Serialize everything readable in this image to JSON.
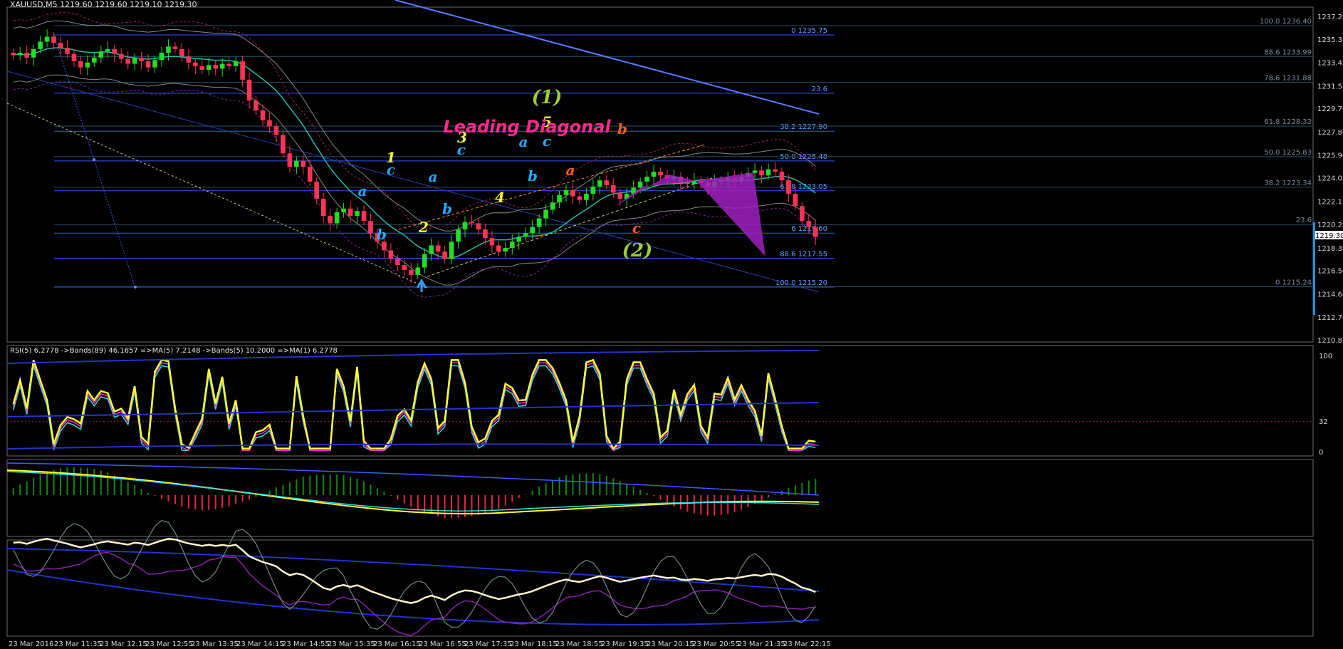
{
  "symbol_header": "XAUUSD,M5  1219.60 1219.60 1219.10 1219.30",
  "rsi_header": "RSI(5) 6.2778  ->Bands(89) 46.1657  =>MA(5) 7.2148  ->Bands(5) 10.2000  =>MA(1) 6.2778",
  "annotation_title": "Leading Diagonal",
  "current_price": "1219.30",
  "colors": {
    "bull": "#22dd22",
    "bear": "#ff3355",
    "fib_line": "#3355ff",
    "trend_line": "#3a5bff",
    "magenta": "#a020c0",
    "rsi": "#ffff33",
    "cyan": "#33dddd",
    "pink": "#ff33cc",
    "accent_title": "#ff2a8a"
  },
  "price_axis": {
    "ticks": [
      "1237.20",
      "1235.35",
      "1233.45",
      "1231.55",
      "1229.70",
      "1227.80",
      "1225.90",
      "1224.05",
      "1222.15",
      "1220.25",
      "1218.35",
      "1216.50",
      "1214.60",
      "1212.70",
      "1210.85"
    ],
    "min": 1210.85,
    "max": 1237.2
  },
  "rsi_axis": {
    "ticks": [
      "100",
      "32",
      "0"
    ]
  },
  "time_axis": {
    "labels": [
      "23 Mar 2016",
      "23 Mar 11:35",
      "23 Mar 12:15",
      "23 Mar 12:55",
      "23 Mar 13:35",
      "23 Mar 14:15",
      "23 Mar 14:55",
      "23 Mar 15:35",
      "23 Mar 16:15",
      "23 Mar 16:55",
      "23 Mar 17:35",
      "23 Mar 18:15",
      "23 Mar 18:55",
      "23 Mar 19:35",
      "23 Mar 20:15",
      "23 Mar 20:55",
      "23 Mar 21:35",
      "23 Mar 22:15"
    ]
  },
  "fib_levels_main": [
    {
      "label": "0 1235.75",
      "price": 1235.75
    },
    {
      "label": "23.6",
      "price": 1231.0
    },
    {
      "label": "38.2 1227.90",
      "price": 1227.9
    },
    {
      "label": "50.0 1225.48",
      "price": 1225.48
    },
    {
      "label": "61.8 1223.05",
      "price": 1223.05
    },
    {
      "label": "6 1219.60",
      "price": 1219.6
    },
    {
      "label": "88.6 1217.55",
      "price": 1217.55
    },
    {
      "label": "100.0 1215.20",
      "price": 1215.2
    }
  ],
  "fib_levels_right": [
    {
      "label": "100.0 1236.40",
      "price": 1236.5
    },
    {
      "label": "88.6 1233.99",
      "price": 1233.99
    },
    {
      "label": "78.6 1231.88",
      "price": 1231.88
    },
    {
      "label": "61.8 1228.32",
      "price": 1228.32
    },
    {
      "label": "50.0 1225.83",
      "price": 1225.83
    },
    {
      "label": "38.2 1223.34",
      "price": 1223.34
    },
    {
      "label": "23.6",
      "price": 1220.3
    },
    {
      "label": "0 1215.24",
      "price": 1215.24
    }
  ],
  "wave_labels": [
    {
      "text": "1",
      "color": "#ffff33",
      "x": 549,
      "y": 228,
      "size": 20
    },
    {
      "text": "2",
      "color": "#ffff33",
      "x": 595,
      "y": 326,
      "size": 20
    },
    {
      "text": "3",
      "color": "#ffff33",
      "x": 649,
      "y": 200,
      "size": 20
    },
    {
      "text": "4",
      "color": "#ffff33",
      "x": 702,
      "y": 284,
      "size": 20
    },
    {
      "text": "5",
      "color": "#ffff33",
      "x": 768,
      "y": 178,
      "size": 20
    },
    {
      "text": "a",
      "color": "#22aaff",
      "x": 509,
      "y": 275,
      "size": 20
    },
    {
      "text": "b",
      "color": "#22aaff",
      "x": 536,
      "y": 336,
      "size": 20
    },
    {
      "text": "c",
      "color": "#22aaff",
      "x": 549,
      "y": 245,
      "size": 20
    },
    {
      "text": "a",
      "color": "#22aaff",
      "x": 608,
      "y": 255,
      "size": 20
    },
    {
      "text": "b",
      "color": "#22aaff",
      "x": 628,
      "y": 300,
      "size": 20
    },
    {
      "text": "c",
      "color": "#22aaff",
      "x": 648,
      "y": 217,
      "size": 20
    },
    {
      "text": "a",
      "color": "#22aaff",
      "x": 735,
      "y": 206,
      "size": 20
    },
    {
      "text": "b",
      "color": "#22aaff",
      "x": 748,
      "y": 254,
      "size": 20
    },
    {
      "text": "c",
      "color": "#22aaff",
      "x": 768,
      "y": 205,
      "size": 20
    },
    {
      "text": "a",
      "color": "#ff5a1a",
      "x": 801,
      "y": 246,
      "size": 20
    },
    {
      "text": "b",
      "color": "#ff5a1a",
      "x": 874,
      "y": 188,
      "size": 20
    },
    {
      "text": "c",
      "color": "#ff5a1a",
      "x": 894,
      "y": 327,
      "size": 20
    },
    {
      "text": "(1)",
      "color": "#9acd32",
      "x": 768,
      "y": 145,
      "size": 26
    },
    {
      "text": "(2)",
      "color": "#9acd32",
      "x": 895,
      "y": 360,
      "size": 26
    }
  ],
  "chart_data": {
    "type": "candlestick",
    "title": "",
    "symbol": "XAUUSD",
    "timeframe": "M5",
    "ylim": [
      1210.85,
      1237.2
    ],
    "close_series": [
      1234.1,
      1234.3,
      1233.9,
      1234.6,
      1235.2,
      1235.6,
      1235.1,
      1234.7,
      1234.2,
      1233.6,
      1233.1,
      1233.5,
      1233.9,
      1234.4,
      1234.6,
      1234.2,
      1233.8,
      1233.4,
      1233.9,
      1233.6,
      1233.1,
      1233.7,
      1234.3,
      1234.8,
      1234.6,
      1234.0,
      1233.5,
      1233.2,
      1232.9,
      1233.3,
      1233.0,
      1233.4,
      1233.2,
      1233.6,
      1232.1,
      1230.4,
      1229.6,
      1228.8,
      1228.3,
      1227.6,
      1226.1,
      1225.0,
      1225.5,
      1225.0,
      1223.8,
      1222.4,
      1221.0,
      1220.4,
      1221.3,
      1221.6,
      1221.0,
      1221.4,
      1220.6,
      1219.6,
      1218.9,
      1218.2,
      1217.5,
      1217.0,
      1216.6,
      1216.2,
      1216.8,
      1217.9,
      1218.6,
      1218.1,
      1217.5,
      1218.9,
      1219.9,
      1220.5,
      1220.4,
      1219.9,
      1219.2,
      1218.6,
      1218.1,
      1218.4,
      1218.9,
      1219.3,
      1219.6,
      1220.1,
      1220.8,
      1221.5,
      1222.1,
      1222.7,
      1223.1,
      1222.6,
      1222.3,
      1222.8,
      1223.4,
      1223.9,
      1223.5,
      1222.9,
      1222.4,
      1222.8,
      1223.3,
      1223.8,
      1224.2,
      1224.6,
      1224.3,
      1224.0,
      1224.2,
      1223.7,
      1223.6,
      1223.9,
      1223.7,
      1223.4,
      1223.8,
      1223.9,
      1224.1,
      1223.9,
      1224.2,
      1224.5,
      1224.7,
      1224.3,
      1224.8,
      1224.6,
      1223.9,
      1222.8,
      1221.8,
      1220.6,
      1220.1,
      1219.3
    ]
  }
}
